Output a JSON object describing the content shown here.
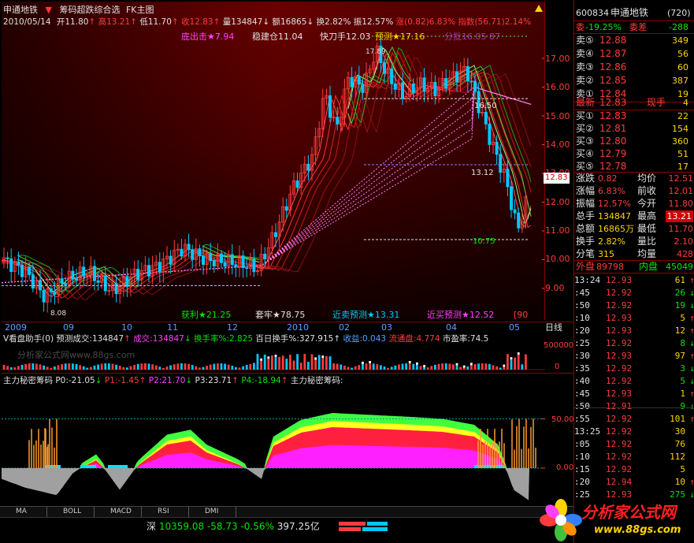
{
  "header": {
    "stock_name": "申通地铁",
    "formula_title": "筹码超跌综合选",
    "chart_mode": "FK主图",
    "date": "2010/05/14",
    "open_label": "开",
    "open": "11.80",
    "high_label": "高",
    "high": "13.21",
    "low_label": "低",
    "low": "11.70",
    "close_label": "收",
    "close": "12.83",
    "volume_label": "量",
    "volume": "134847",
    "amount_label": "额",
    "amount": "16865",
    "turnover_label": "换",
    "turnover": "2.82%",
    "amplitude_label": "振",
    "amplitude": "12.57%",
    "change_label": "涨",
    "change": "(0.82)",
    "change_pct": "6.83%",
    "index_label": "指数",
    "index_value": "(56.71)",
    "index_pct": "2.14%"
  },
  "overlay_labels": {
    "bottom_out": "底出击★7.94",
    "steady": "稳建仓11.04",
    "quick_knife": "快刀手12.03",
    "forecast": "预测★17.16",
    "distribution": "分批16.05 87",
    "profit": "获利★21.25",
    "trapped": "套牢★78.75",
    "near_sell": "近卖预测★13.31",
    "near_buy": "近买预测★12.52",
    "level_1315": "13.12",
    "level_1075": "10.75",
    "level_1650": "16.50",
    "peak": "17.89",
    "trough": "8.08",
    "right_tag": "90"
  },
  "price_axis": {
    "ticks": [
      "17.00",
      "16.00",
      "15.00",
      "14.00",
      "13.00",
      "12.00",
      "11.00",
      "10.00",
      "9.00"
    ],
    "current_price": "12.83"
  },
  "date_axis": {
    "labels": [
      "2009",
      "09",
      "10",
      "11",
      "12",
      "2010",
      "02",
      "03",
      "04",
      "05"
    ],
    "period": "日线"
  },
  "volume_panel": {
    "title": "V看盘助手(0)",
    "forecast_volume": "预测成交:134847",
    "volume": "成交:134847",
    "turnover": "换手率%:2.825",
    "hundred_day_turnover": "百日换手%:327.915",
    "income": "收益:0.043",
    "float_cap": "流通盘:4.774",
    "pe": "市盈率:74.5",
    "axis_top": "500000",
    "axis_zero": "0",
    "watermark": "分析家公式网www.88gs.com"
  },
  "indicator_panel": {
    "title": "主力秘密筹码",
    "p0": "P0:-21.05",
    "p1": "P1:-1.45",
    "p2": "P2:21.70",
    "p3": "P3:23.71",
    "p4": "P4:-18.94",
    "suffix": "主力秘密筹码:",
    "axis_50": "50.00",
    "axis_0": "0.00"
  },
  "tabs": [
    {
      "label": "MA"
    },
    {
      "label": "BOLL"
    },
    {
      "label": "MACD"
    },
    {
      "label": "RSI"
    },
    {
      "label": "DMI"
    }
  ],
  "status_bar": {
    "market": "深",
    "index": "10359.08",
    "change": "-58.73",
    "change_pct": "-0.56%",
    "amount": "397.25亿"
  },
  "quote": {
    "code": "600834",
    "name": "申通地铁",
    "board": "(720)",
    "wb_label": "委",
    "wb_value": "-19.25%",
    "wc_label": "委差",
    "wc_value": "-288",
    "sells": [
      {
        "label": "卖⑤",
        "price": "12.88",
        "vol": "349"
      },
      {
        "label": "卖④",
        "price": "12.87",
        "vol": "56"
      },
      {
        "label": "卖③",
        "price": "12.86",
        "vol": "60"
      },
      {
        "label": "卖②",
        "price": "12.85",
        "vol": "387"
      },
      {
        "label": "卖①",
        "price": "12.84",
        "vol": "19"
      }
    ],
    "latest_label": "最新",
    "latest": "12.83",
    "hand_label": "现手",
    "hand": "4",
    "buys": [
      {
        "label": "买①",
        "price": "12.83",
        "vol": "22"
      },
      {
        "label": "买②",
        "price": "12.81",
        "vol": "154"
      },
      {
        "label": "买③",
        "price": "12.80",
        "vol": "360"
      },
      {
        "label": "买④",
        "price": "12.79",
        "vol": "51"
      },
      {
        "label": "买⑤",
        "price": "12.78",
        "vol": "17"
      }
    ],
    "stats": [
      {
        "l1": "涨跌",
        "v1": "0.82",
        "l2": "均价",
        "v2": "12.51"
      },
      {
        "l1": "涨幅",
        "v1": "6.83%",
        "l2": "前收",
        "v2": "12.01"
      },
      {
        "l1": "振幅",
        "v1": "12.57%",
        "l2": "今开",
        "v2": "11.80"
      },
      {
        "l1": "总手",
        "v1": "134847",
        "l2": "最高",
        "v2": "13.21"
      },
      {
        "l1": "总额",
        "v1": "16865万",
        "l2": "最低",
        "v2": "11.70"
      },
      {
        "l1": "换手",
        "v1": "2.82%",
        "l2": "量比",
        "v2": "2.10"
      },
      {
        "l1": "分笔",
        "v1": "315",
        "l2": "均量",
        "v2": "428"
      }
    ],
    "outer_label": "外盘",
    "outer": "89798",
    "inner_label": "内盘",
    "inner": "45049"
  },
  "ticks": [
    {
      "time": "13:24",
      "price": "12.93",
      "vol": "61",
      "dir": "up"
    },
    {
      "time": ":45",
      "price": "12.92",
      "vol": "26",
      "dir": "down"
    },
    {
      "time": ":50",
      "price": "12.92",
      "vol": "19",
      "dir": "down"
    },
    {
      "time": ":10",
      "price": "12.93",
      "vol": "5",
      "dir": "up"
    },
    {
      "time": ":20",
      "price": "12.93",
      "vol": "12",
      "dir": "up"
    },
    {
      "time": ":25",
      "price": "12.92",
      "vol": "8",
      "dir": "down"
    },
    {
      "time": ":30",
      "price": "12.93",
      "vol": "97",
      "dir": "up"
    },
    {
      "time": ":35",
      "price": "12.92",
      "vol": "3",
      "dir": "down"
    },
    {
      "time": ":40",
      "price": "12.92",
      "vol": "5",
      "dir": "down"
    },
    {
      "time": ":45",
      "price": "12.93",
      "vol": "1",
      "dir": "up"
    },
    {
      "time": ":50",
      "price": "12.91",
      "vol": "9",
      "dir": "down"
    },
    {
      "time": ":55",
      "price": "12.92",
      "vol": "101",
      "dir": "up"
    },
    {
      "time": "13:25",
      "price": "12.92",
      "vol": "30",
      "dir": "none"
    },
    {
      "time": ":05",
      "price": "12.92",
      "vol": "76",
      "dir": "none"
    },
    {
      "time": ":10",
      "price": "12.92",
      "vol": "112",
      "dir": "none"
    },
    {
      "time": ":15",
      "price": "12.92",
      "vol": "5",
      "dir": "none"
    },
    {
      "time": ":20",
      "price": "12.94",
      "vol": "10",
      "dir": "up"
    },
    {
      "time": ":25",
      "price": "12.93",
      "vol": "275",
      "dir": "down"
    }
  ],
  "logo": {
    "text": "分析家公式网",
    "url": "www.88gs.com"
  },
  "colors": {
    "up": "#ff3c3c",
    "down": "#00e600",
    "axis": "#8b0000",
    "magenta": "#ff40ff",
    "yellow": "#ffd400",
    "cyan": "#00c8ff"
  }
}
